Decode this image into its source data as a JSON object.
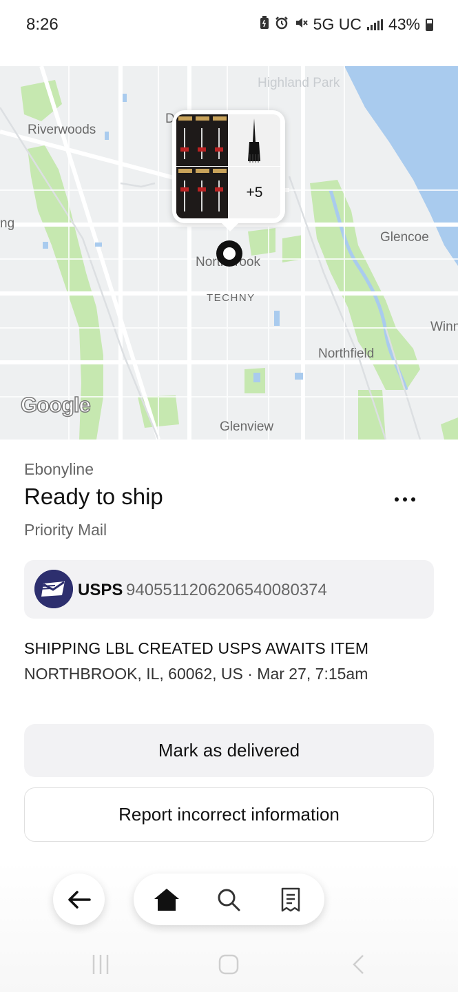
{
  "status_bar": {
    "time": "8:26",
    "network": "5G UC",
    "battery": "43%",
    "icons": [
      "battery-saver-icon",
      "alarm-icon",
      "mute-icon",
      "signal-icon",
      "battery-icon"
    ]
  },
  "map": {
    "labels": {
      "highland_park": "Highland Park",
      "riverwoods": "Riverwoods",
      "deerfield_partial": "D",
      "glencoe": "Glencoe",
      "left_partial": "ng",
      "northbrook": "Northbrook",
      "techny": "TECHNY",
      "winnetka_partial": "Winn",
      "northfield": "Northfield",
      "glenview": "Glenview"
    },
    "provider_logo": "Google",
    "popup": {
      "more_count": "+5"
    },
    "colors": {
      "water": "#a9cbee",
      "park": "#c6e8b0",
      "land": "#eef0f1"
    }
  },
  "order": {
    "seller": "Ebonyline",
    "status": "Ready to ship",
    "shipping_method": "Priority Mail"
  },
  "tracking": {
    "carrier": "USPS",
    "number": "9405511206206540080374"
  },
  "latest_event": {
    "title": "SHIPPING LBL CREATED USPS AWAITS ITEM",
    "detail": "NORTHBROOK, IL, 60062, US · Mar 27, 7:15am"
  },
  "actions": {
    "mark_delivered": "Mark as delivered",
    "report_incorrect": "Report incorrect information"
  },
  "bottom_nav": {
    "items": [
      "home-icon",
      "search-icon",
      "orders-icon"
    ],
    "active": "home"
  }
}
